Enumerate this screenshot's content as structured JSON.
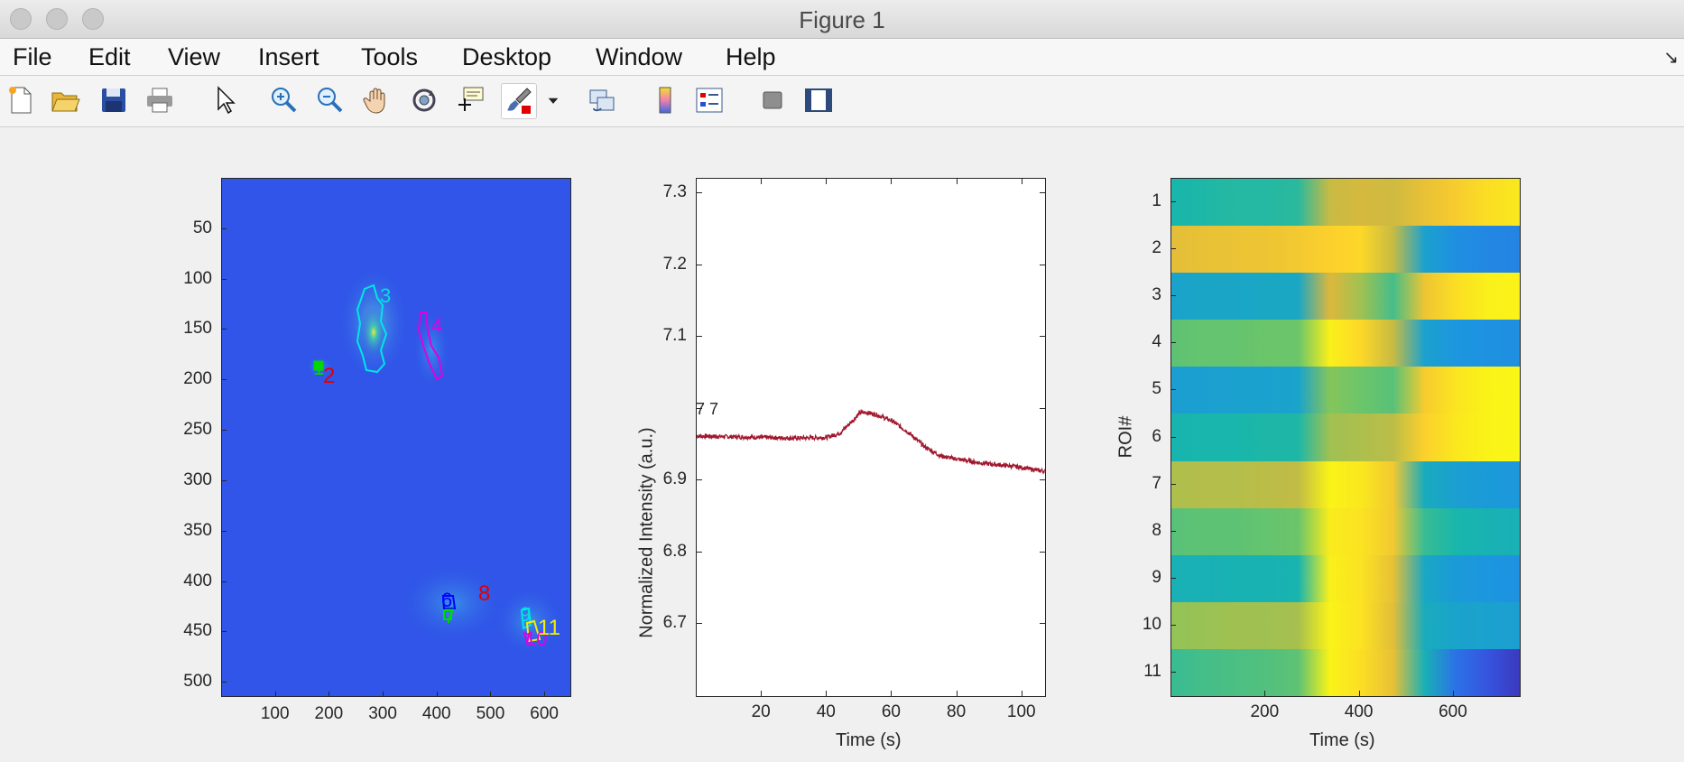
{
  "window": {
    "title": "Figure 1"
  },
  "menu": [
    "File",
    "Edit",
    "View",
    "Insert",
    "Tools",
    "Desktop",
    "Window",
    "Help"
  ],
  "toolbar": [
    {
      "name": "new-figure-icon"
    },
    {
      "name": "open-file-icon"
    },
    {
      "name": "save-icon"
    },
    {
      "name": "print-icon"
    },
    {
      "name": "edit-plot-arrow-icon"
    },
    {
      "name": "zoom-in-icon"
    },
    {
      "name": "zoom-out-icon"
    },
    {
      "name": "pan-hand-icon"
    },
    {
      "name": "rotate-3d-icon"
    },
    {
      "name": "data-cursor-icon"
    },
    {
      "name": "brush-icon"
    },
    {
      "name": "brush-dropdown-icon"
    },
    {
      "name": "link-plot-icon"
    },
    {
      "name": "insert-colorbar-icon"
    },
    {
      "name": "insert-legend-icon"
    },
    {
      "name": "hide-plot-tools-icon"
    },
    {
      "name": "show-plot-tools-icon"
    }
  ],
  "image_axes": {
    "xticks": [
      "100",
      "200",
      "300",
      "400",
      "500",
      "600"
    ],
    "yticks": [
      "50",
      "100",
      "150",
      "200",
      "250",
      "300",
      "350",
      "400",
      "450",
      "500"
    ],
    "roi_labels": [
      {
        "label": "1",
        "color": "#00d800"
      },
      {
        "label": "2",
        "color": "#e00000"
      },
      {
        "label": "3",
        "color": "#00e0e0"
      },
      {
        "label": "4",
        "color": "#e000e0"
      },
      {
        "label": "6",
        "color": "#0000ff"
      },
      {
        "label": "7",
        "color": "#00d800"
      },
      {
        "label": "8",
        "color": "#e00000"
      },
      {
        "label": "9",
        "color": "#00e0e0"
      },
      {
        "label": "10",
        "color": "#e000e0"
      },
      {
        "label": "11",
        "color": "#f0f000"
      }
    ]
  },
  "chart_data": [
    {
      "type": "line",
      "title": "",
      "xlabel": "Time (s)",
      "ylabel": "Normalized Intensity (a.u.)",
      "xlim": [
        0,
        107
      ],
      "ylim": [
        6.6,
        7.32
      ],
      "xticks": [
        "20",
        "40",
        "60",
        "80",
        "100"
      ],
      "yticks": [
        "6.7",
        "6.8",
        "6.9",
        "7",
        "7.1",
        "7.2",
        "7.3"
      ],
      "ytick_overlay_text": "7 7",
      "series": [
        {
          "color": "#a0182e",
          "x": [
            0,
            10,
            20,
            30,
            40,
            44,
            48,
            50,
            52,
            55,
            60,
            65,
            70,
            75,
            80,
            85,
            90,
            95,
            100,
            105,
            107
          ],
          "y": [
            6.962,
            6.961,
            6.96,
            6.959,
            6.96,
            6.966,
            6.984,
            6.994,
            6.995,
            6.992,
            6.983,
            6.967,
            6.947,
            6.934,
            6.93,
            6.926,
            6.923,
            6.921,
            6.918,
            6.914,
            6.913
          ]
        }
      ]
    },
    {
      "type": "heatmap",
      "title": "",
      "xlabel": "Time (s)",
      "ylabel": "ROI#",
      "xlim": [
        0,
        740
      ],
      "xticks": [
        "200",
        "400",
        "600"
      ],
      "rows": [
        "1",
        "2",
        "3",
        "4",
        "5",
        "6",
        "7",
        "8",
        "9",
        "10",
        "11"
      ],
      "row_profiles": [
        [
          0.45,
          0.46,
          0.47,
          0.47,
          0.48,
          0.72,
          0.74,
          0.73,
          0.8,
          0.86,
          0.92,
          0.95
        ],
        [
          0.78,
          0.8,
          0.81,
          0.82,
          0.84,
          0.88,
          0.9,
          0.72,
          0.35,
          0.28,
          0.26,
          0.25
        ],
        [
          0.36,
          0.37,
          0.37,
          0.38,
          0.38,
          0.75,
          0.66,
          0.52,
          0.82,
          0.92,
          0.97,
          0.98
        ],
        [
          0.56,
          0.57,
          0.57,
          0.58,
          0.58,
          0.97,
          0.9,
          0.72,
          0.35,
          0.3,
          0.29,
          0.28
        ],
        [
          0.34,
          0.34,
          0.35,
          0.35,
          0.36,
          0.62,
          0.58,
          0.55,
          0.86,
          0.94,
          0.98,
          0.99
        ],
        [
          0.44,
          0.45,
          0.45,
          0.46,
          0.46,
          0.66,
          0.68,
          0.7,
          0.88,
          0.95,
          0.98,
          0.99
        ],
        [
          0.68,
          0.69,
          0.69,
          0.7,
          0.71,
          0.98,
          0.95,
          0.84,
          0.4,
          0.34,
          0.32,
          0.31
        ],
        [
          0.55,
          0.56,
          0.56,
          0.57,
          0.58,
          0.96,
          0.93,
          0.84,
          0.5,
          0.45,
          0.43,
          0.42
        ],
        [
          0.42,
          0.42,
          0.43,
          0.43,
          0.44,
          0.97,
          0.93,
          0.8,
          0.38,
          0.32,
          0.3,
          0.29
        ],
        [
          0.64,
          0.65,
          0.66,
          0.66,
          0.67,
          0.98,
          0.93,
          0.78,
          0.4,
          0.36,
          0.35,
          0.34
        ],
        [
          0.5,
          0.52,
          0.53,
          0.54,
          0.56,
          0.98,
          0.92,
          0.8,
          0.42,
          0.2,
          0.12,
          0.05
        ]
      ],
      "colormap": "parula"
    }
  ]
}
